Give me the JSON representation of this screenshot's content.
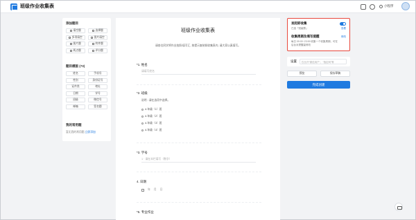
{
  "app": {
    "title": "班级作业收集表",
    "mini_program": "小程序"
  },
  "left_panel": {
    "add_section": "添加题目",
    "add_buttons": [
      {
        "label": "填空题",
        "icon": "text-icon"
      },
      {
        "label": "选择题",
        "icon": "choice-icon"
      },
      {
        "label": "多项填空",
        "icon": "multi-fill-icon"
      },
      {
        "label": "图片填空",
        "icon": "image-fill-icon"
      },
      {
        "label": "图片题",
        "icon": "image-icon"
      },
      {
        "label": "附件题",
        "icon": "attachment-icon"
      },
      {
        "label": "两点题",
        "icon": "location-icon"
      },
      {
        "label": "评分题",
        "icon": "rating-icon"
      }
    ],
    "template_section": "题目模版 (73)",
    "template_buttons": [
      "姓名",
      "手机号",
      "性别",
      "身份证号",
      "证件类",
      "地址",
      "日期",
      "学号",
      "班级",
      "微信号",
      "邮箱",
      "签名题"
    ],
    "common_section": "我的常用题",
    "common_empty": "暂无我的常用题,",
    "common_link": "立即添加"
  },
  "document": {
    "title": "班级作业收集表",
    "description": "请各位同学将作业拍照/填写汇, 按提示复制如收集表内, 请大家以真填写。",
    "questions": [
      {
        "num": "*1.",
        "label": "姓名",
        "placeholder": "请填写姓名"
      },
      {
        "num": "*2.",
        "label": "班级",
        "note": "说明 : 请在选项中选择。",
        "options": [
          "A 年级（1）班",
          "A 年级（2）班",
          "A 年级（3）班",
          "A 年级（4）班"
        ]
      },
      {
        "num": "*3.",
        "label": "学号",
        "placeholder": "1 · 请在本栏填写（数字）"
      },
      {
        "num": "4.",
        "label": "日期",
        "date_parts": [
          "年",
          "月",
          "日"
        ]
      },
      {
        "num": "*5.",
        "label": "专业作业"
      }
    ]
  },
  "right_panel": {
    "collect_title": "发起即收集",
    "collect_desc": "已选「班级群」",
    "collect_link": "查看",
    "cycle_title": "收集周期及填写提醒",
    "cycle_link": "修改",
    "cycle_desc": "每日 09:00~23:59 收集一个收集周期，可在后台对提醒量修改",
    "settings_label": "设置",
    "settings_placeholder": "仅允许“微信用户”、“指定网”等",
    "preview_btn": "预览",
    "save_btn": "保存草稿",
    "publish_btn": "完成创建"
  }
}
